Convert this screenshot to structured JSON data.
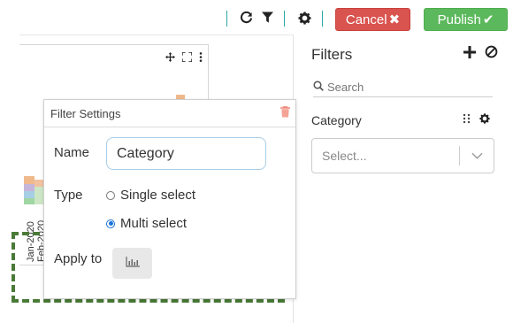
{
  "toolbar": {
    "refresh_icon": "refresh-icon",
    "filter_icon": "funnel-icon",
    "settings_icon": "gear-icon",
    "cancel_label": "Cancel",
    "publish_label": "Publish",
    "colors": {
      "cancel": "#d9534f",
      "publish": "#5cb85c",
      "separator": "#2ba8a8"
    }
  },
  "chart_panel": {
    "tools": [
      "move-icon",
      "expand-icon",
      "more-vertical-icon"
    ],
    "x_labels": [
      "Jan-2020",
      "Feb-2020"
    ]
  },
  "filters": {
    "title": "Filters",
    "search_placeholder": "Search",
    "category_label": "Category",
    "category_select_placeholder": "Select..."
  },
  "popup": {
    "title": "Filter Settings",
    "name_label": "Name",
    "name_value": "Category",
    "type_label": "Type",
    "type_options": [
      "Single select",
      "Multi select"
    ],
    "type_selected": "Multi select",
    "apply_label": "Apply to"
  },
  "dropzone": {
    "color": "#4a7a37"
  }
}
